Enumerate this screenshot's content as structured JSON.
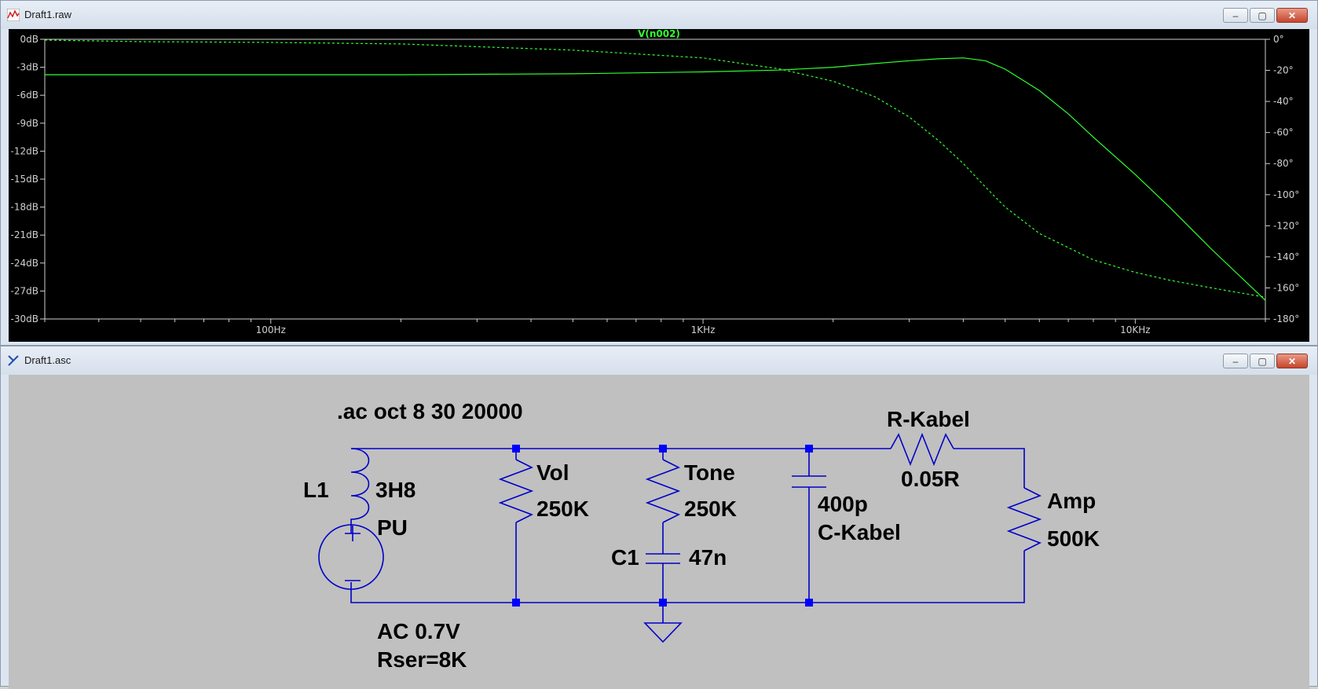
{
  "plot_window": {
    "title": "Draft1.raw",
    "trace_name": "V(n002)",
    "colors": {
      "background": "#000000",
      "trace": "#30ff30",
      "axis": "#d0d0d0"
    }
  },
  "chart_data": {
    "type": "line",
    "x_scale": "log",
    "xlim": [
      30,
      20000
    ],
    "x_ticks": [
      "100Hz",
      "1KHz",
      "10KHz"
    ],
    "left_axis": {
      "ylim": [
        -30,
        0
      ],
      "ticks": [
        "0dB",
        "-3dB",
        "-6dB",
        "-9dB",
        "-12dB",
        "-15dB",
        "-18dB",
        "-21dB",
        "-24dB",
        "-27dB",
        "-30dB"
      ]
    },
    "right_axis": {
      "ylim": [
        -180,
        0
      ],
      "ticks": [
        "0°",
        "-20°",
        "-40°",
        "-60°",
        "-80°",
        "-100°",
        "-120°",
        "-140°",
        "-160°",
        "-180°"
      ]
    },
    "series": [
      {
        "style": "solid",
        "x": [
          30,
          50,
          100,
          200,
          500,
          1000,
          1500,
          2000,
          2500,
          3000,
          3500,
          4000,
          4500,
          5000,
          6000,
          7000,
          8000,
          10000,
          12000,
          15000,
          20000
        ],
        "y": [
          -3.8,
          -3.8,
          -3.8,
          -3.8,
          -3.7,
          -3.5,
          -3.3,
          -3.0,
          -2.6,
          -2.3,
          -2.1,
          -2.0,
          -2.3,
          -3.2,
          -5.5,
          -8.0,
          -10.5,
          -14.5,
          -18.0,
          -22.5,
          -28.0
        ]
      },
      {
        "style": "dashed",
        "x": [
          30,
          50,
          100,
          200,
          500,
          1000,
          1500,
          2000,
          2500,
          3000,
          3500,
          4000,
          4500,
          5000,
          6000,
          8000,
          10000,
          12000,
          15000,
          20000
        ],
        "y": [
          -0.5,
          -1.5,
          -2.0,
          -3.0,
          -7.0,
          -12.0,
          -19.0,
          -27.0,
          -37.0,
          -50.0,
          -65.0,
          -80.0,
          -95.0,
          -108.0,
          -125.0,
          -142.0,
          -150.0,
          -155.0,
          -160.0,
          -166.0
        ]
      }
    ]
  },
  "schematic_window": {
    "title": "Draft1.asc",
    "colors": {
      "background": "#c0c0c0",
      "wire": "#0000c8",
      "junction": "#0000ff",
      "text": "#000000"
    },
    "directive": ".ac oct 8 30 20000",
    "components": {
      "inductor": {
        "name": "L1",
        "value": "3H8"
      },
      "source": {
        "name": "PU",
        "value": "AC 0.7V",
        "param": "Rser=8K"
      },
      "vol": {
        "name": "Vol",
        "value": "250K"
      },
      "tone": {
        "name": "Tone",
        "value": "250K"
      },
      "c1": {
        "name": "C1",
        "value": "47n"
      },
      "ckabel": {
        "name": "C-Kabel",
        "value": "400p"
      },
      "rkabel": {
        "name": "R-Kabel",
        "value": "0.05R"
      },
      "amp": {
        "name": "Amp",
        "value": "500K"
      }
    }
  },
  "window_buttons": {
    "minimize": "–",
    "maximize": "▢",
    "close": "✕"
  }
}
